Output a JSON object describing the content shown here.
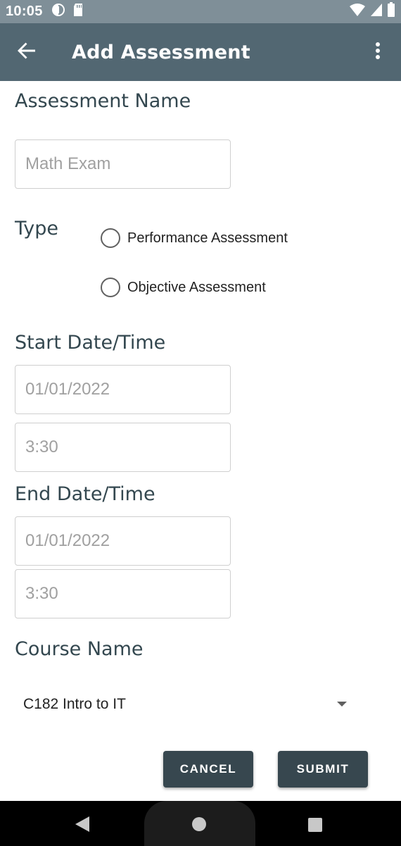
{
  "status_bar": {
    "time": "10:05",
    "icons": [
      "data-saver-icon",
      "sd-card-icon",
      "wifi-icon",
      "signal-icon",
      "battery-icon"
    ]
  },
  "app_bar": {
    "title": "Add Assessment",
    "back_icon": "arrow-back-icon",
    "menu_icon": "more-vert-icon"
  },
  "form": {
    "assessment_name": {
      "label": "Assessment Name",
      "placeholder": "Math Exam",
      "value": ""
    },
    "type": {
      "label": "Type",
      "options": [
        {
          "label": "Performance Assessment",
          "selected": false
        },
        {
          "label": "Objective Assessment",
          "selected": false
        }
      ]
    },
    "start": {
      "label": "Start Date/Time",
      "date_placeholder": "01/01/2022",
      "time_placeholder": "3:30"
    },
    "end": {
      "label": "End Date/Time",
      "date_placeholder": "01/01/2022",
      "time_placeholder": "3:30"
    },
    "course": {
      "label": "Course Name",
      "selected": "C182 Intro to IT"
    }
  },
  "buttons": {
    "cancel": "CANCEL",
    "submit": "SUBMIT"
  },
  "colors": {
    "status_bar": "#7f8f98",
    "app_bar": "#526772",
    "button": "#37474f",
    "label_text": "#33474f"
  }
}
